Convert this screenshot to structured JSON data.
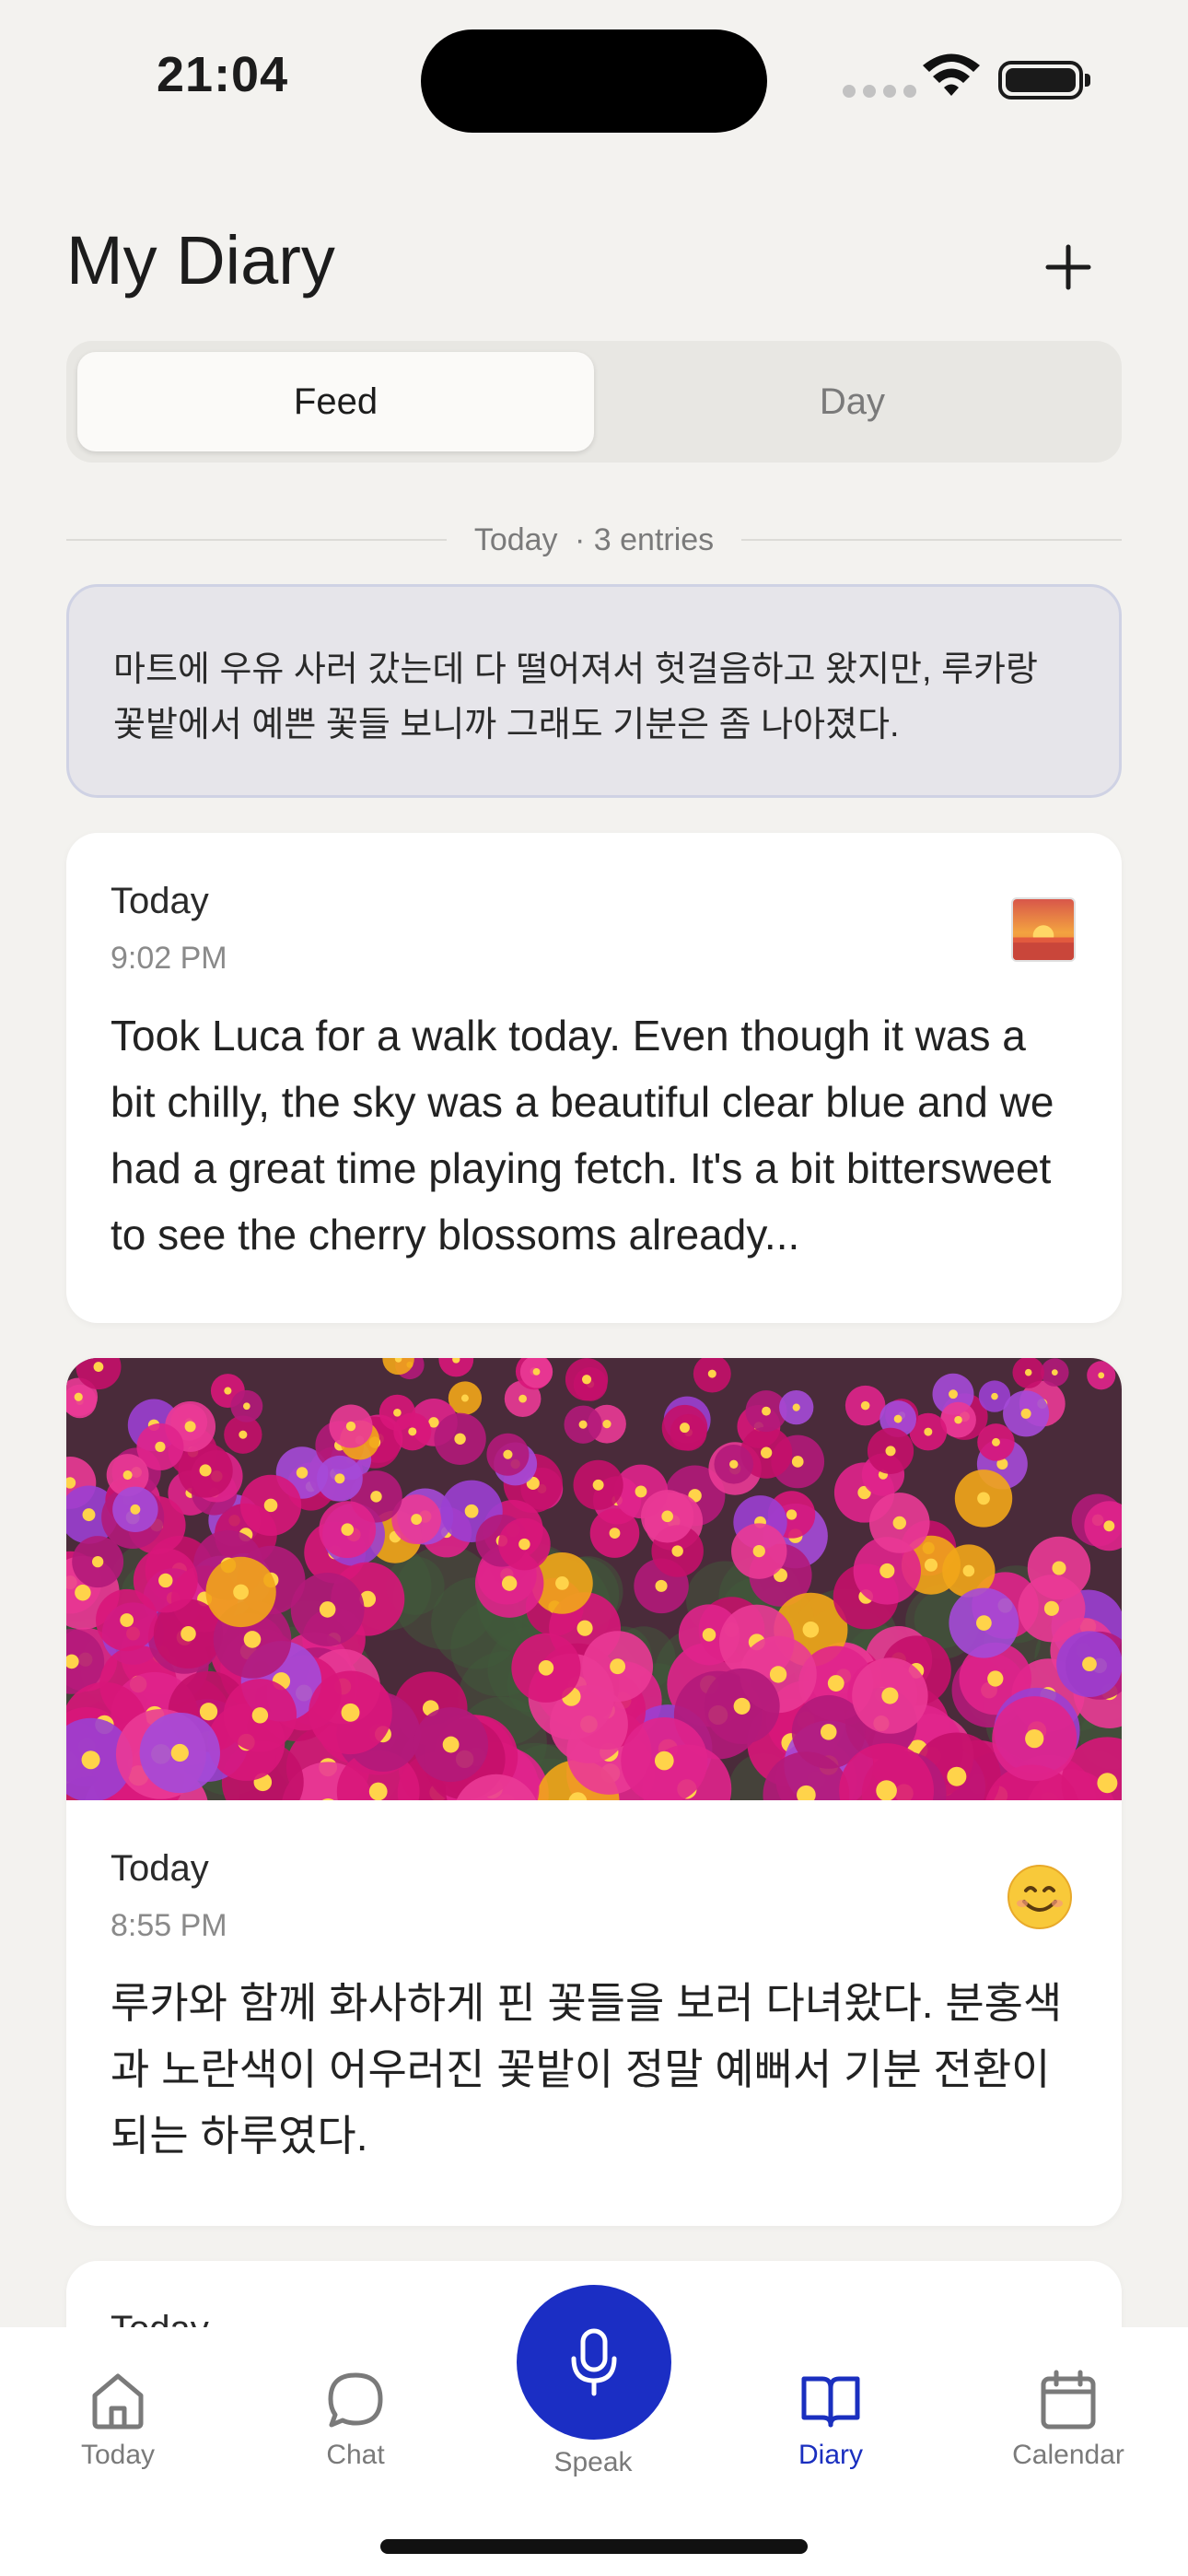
{
  "status_bar": {
    "time": "21:04"
  },
  "header": {
    "title": "My Diary"
  },
  "tabs": [
    {
      "label": "Feed",
      "active": true
    },
    {
      "label": "Day",
      "active": false
    }
  ],
  "date_divider": {
    "label": "Today",
    "count": "· 3 entries"
  },
  "summary": {
    "text": "마트에 우유 사러 갔는데 다 떨어져서 헛걸음하고 왔지만, 루카랑 꽃밭에서 예쁜 꽃들 보니까 그래도 기분은 좀 나아졌다."
  },
  "entries": [
    {
      "day": "Today",
      "time": "9:02 PM",
      "text": "Took Luca for a walk today. Even though it was a bit chilly, the sky was a beautiful clear blue and we had a great time playing fetch. It's a bit bittersweet to see the cherry blossoms already..."
    },
    {
      "day": "Today",
      "time": "8:55 PM",
      "text": "루카와 함께 화사하게 핀 꽃들을 보러 다녀왔다. 분홍색과 노란색이 어우러진 꽃밭이 정말 예뻐서 기분 전환이 되는 하루였다.",
      "mood": "😊"
    },
    {
      "day": "Today"
    }
  ],
  "bottom_nav": {
    "today": "Today",
    "chat": "Chat",
    "speak": "Speak",
    "diary": "Diary",
    "calendar": "Calendar"
  },
  "colors": {
    "accent": "#1b2ec4",
    "background": "#f3f2ef",
    "summary_bg": "#e6e5ea"
  }
}
